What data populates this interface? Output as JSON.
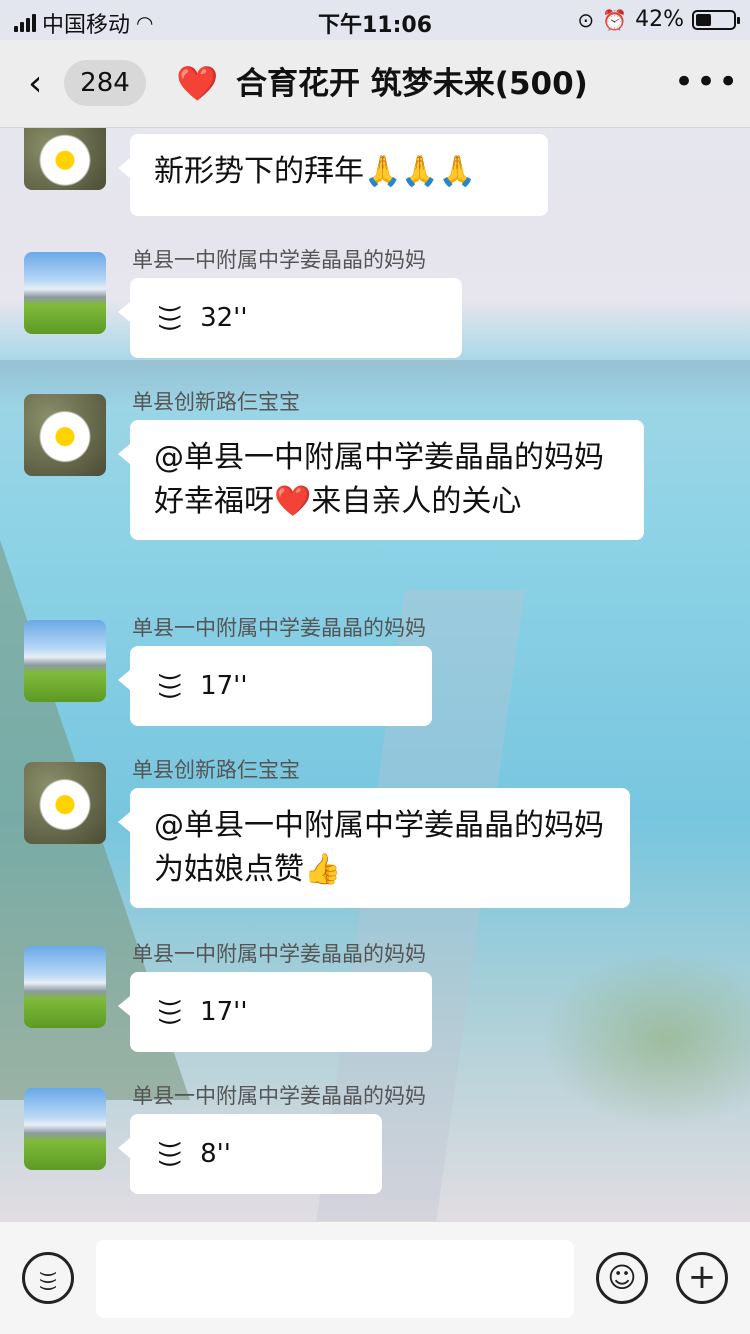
{
  "status_bar": {
    "carrier": "中国移动",
    "time": "下午11:06",
    "battery": "42%",
    "battery_level": 0.42
  },
  "header": {
    "back_icon": "chevron-left-icon",
    "unread_count": "284",
    "heart_icon": "❤️",
    "title": "合育花开 筑梦未来(500)",
    "more_icon": "more-icon"
  },
  "messages": [
    {
      "type": "text",
      "avatar": "daisy",
      "sender": "",
      "text": "新形势下的拜年🙏🙏🙏"
    },
    {
      "type": "voice",
      "avatar": "mountain",
      "sender": "单县一中附属中学姜晶晶的妈妈",
      "duration": "32''"
    },
    {
      "type": "text",
      "avatar": "daisy",
      "sender": "单县创新路仨宝宝",
      "text": "@单县一中附属中学姜晶晶的妈妈 好幸福呀❤️来自亲人的关心"
    },
    {
      "type": "voice",
      "avatar": "mountain",
      "sender": "单县一中附属中学姜晶晶的妈妈",
      "duration": "17''"
    },
    {
      "type": "text",
      "avatar": "daisy",
      "sender": "单县创新路仨宝宝",
      "text": "@单县一中附属中学姜晶晶的妈妈 为姑娘点赞👍"
    },
    {
      "type": "voice",
      "avatar": "mountain",
      "sender": "单县一中附属中学姜晶晶的妈妈",
      "duration": "17''"
    },
    {
      "type": "voice",
      "avatar": "mountain",
      "sender": "单县一中附属中学姜晶晶的妈妈",
      "duration": "8''"
    }
  ],
  "input_bar": {
    "voice_icon": "voice-input-icon",
    "emoji_icon": "emoji-icon",
    "plus_icon": "plus-icon"
  }
}
